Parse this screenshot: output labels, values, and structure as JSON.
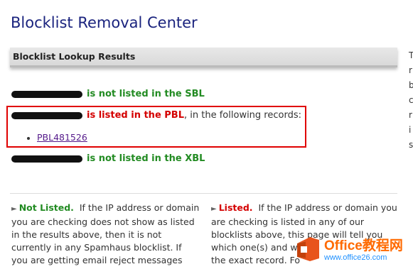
{
  "page": {
    "title": "Blocklist Removal Center"
  },
  "section": {
    "header": "Blocklist Lookup Results"
  },
  "results": {
    "sbl": {
      "status_text": "is not listed in the SBL"
    },
    "pbl": {
      "status_text": "is listed in the PBL",
      "suffix": ", in the following records:"
    },
    "records": [
      "PBL481526"
    ],
    "xbl": {
      "status_text": "is not listed in the XBL"
    }
  },
  "legend": {
    "not_listed": {
      "label": "Not Listed.",
      "lines": [
        "If the IP address or domain",
        "you are checking does not show as listed",
        "in the results above, then it is not",
        "currently in any Spamhaus blocklist. If",
        "you are getting email reject messages"
      ]
    },
    "listed": {
      "label": "Listed.",
      "lines": [
        "If the IP address or domain you",
        "are checking is listed in any of our",
        "blocklists above, this page will tell you",
        "which one(s) and w",
        "the exact record. Fo"
      ]
    }
  },
  "right_edge_chars": [
    "T",
    "r",
    "b",
    "c",
    "r",
    "i",
    "s"
  ],
  "watermark": {
    "title": "Office教程网",
    "url": "www.office26.com"
  },
  "colors": {
    "not_listed": "#228b22",
    "listed": "#d40000",
    "title": "#1a237e",
    "highlight": "#e00000"
  }
}
